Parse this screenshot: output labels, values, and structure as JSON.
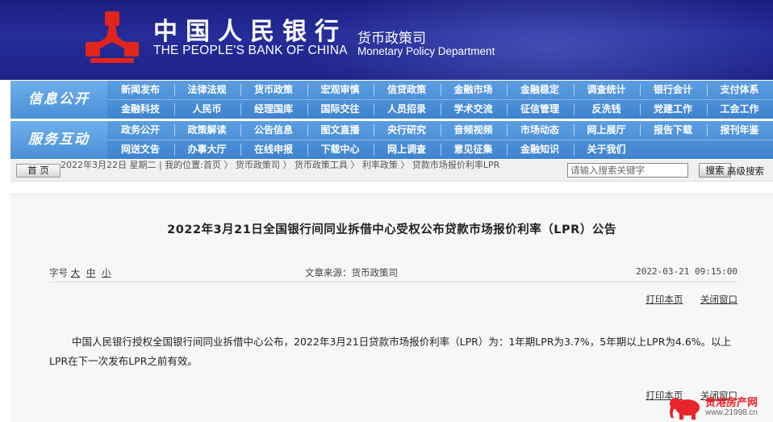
{
  "header": {
    "bank_name_cn": "中国人民银行",
    "bank_name_en": "THE PEOPLE'S BANK OF CHINA",
    "dept_cn": "货币政策司",
    "dept_en": "Monetary Policy Department",
    "emblem_color": "#e1251b"
  },
  "nav": {
    "info_label": "信息公开",
    "info_rows": [
      [
        "新闻发布",
        "法律法规",
        "货币政策",
        "宏观审慎",
        "信贷政策",
        "金融市场",
        "金融稳定",
        "调查统计",
        "银行会计",
        "支付体系"
      ],
      [
        "金融科技",
        "人民币",
        "经理国库",
        "国际交往",
        "人员招录",
        "学术交流",
        "征信管理",
        "反洗钱",
        "党建工作",
        "工会工作"
      ]
    ],
    "service_label": "服务互动",
    "service_rows": [
      [
        "政务公开",
        "政策解读",
        "公告信息",
        "图文直播",
        "央行研究",
        "音频视频",
        "市场动态",
        "网上展厅",
        "报告下载",
        "报刊年鉴"
      ],
      [
        "网送文告",
        "办事大厅",
        "在线申报",
        "下载中心",
        "网上调查",
        "意见征集",
        "金融知识",
        "关于我们"
      ]
    ],
    "accent_color": "#4a8fd6"
  },
  "breadcrumb": {
    "home_label": "首 页",
    "text": "2022年3月22日 星期二 | 我的位置:首页 〉 货币政策司 〉 货币政策工具 〉 利率政策 〉 贷款市场报价利率LPR",
    "search_placeholder": "请输入搜索关键字",
    "search_button": "搜索",
    "advanced_search": "高级搜索"
  },
  "article": {
    "title": "2022年3月21日全国银行间同业拆借中心受权公布贷款市场报价利率（LPR）公告",
    "font_label": "字号",
    "font_sizes": [
      "大",
      "中",
      "小"
    ],
    "source": "文章来源：货币政策司",
    "date": "2022-03-21 09:15:00",
    "print_label": "打印本页",
    "close_label": "关闭窗口",
    "body": "中国人民银行授权全国银行间同业拆借中心公布，2022年3月21日贷款市场报价利率（LPR）为：1年期LPR为3.7%，5年期以上LPR为4.6%。以上LPR在下一次发布LPR之前有效。"
  },
  "watermark": {
    "name": "贵港房产网",
    "url": "www.21998.cn"
  }
}
